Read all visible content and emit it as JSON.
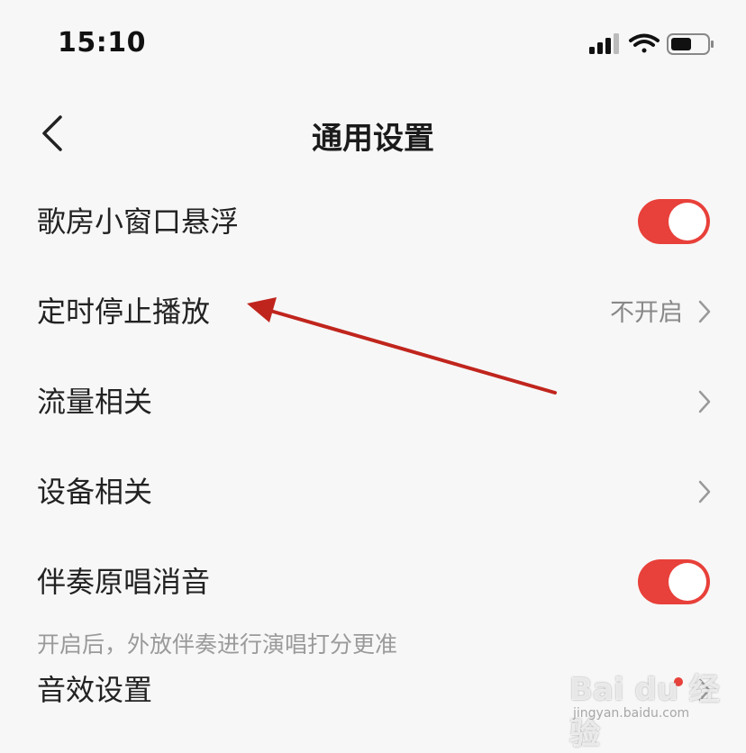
{
  "status_bar": {
    "time": "15:10",
    "icons": [
      "signal-icon",
      "wifi-icon",
      "battery-icon"
    ]
  },
  "nav": {
    "title": "通用设置",
    "back_icon": "chevron-left-icon"
  },
  "settings": [
    {
      "label": "歌房小窗口悬浮",
      "control": "toggle",
      "on": true
    },
    {
      "label": "定时停止播放",
      "control": "chevron",
      "value": "不开启"
    },
    {
      "label": "流量相关",
      "control": "chevron"
    },
    {
      "label": "设备相关",
      "control": "chevron"
    },
    {
      "label": "伴奏原唱消音",
      "control": "toggle",
      "on": true,
      "hint": "开启后，外放伴奏进行演唱打分更准"
    },
    {
      "label": "音效设置",
      "control": "chevron",
      "badge": true
    }
  ],
  "watermark": {
    "brand": "Bai du 经验",
    "url": "jingyan.baidu.com"
  },
  "colors": {
    "accent": "#e8403a",
    "background": "#f7f7f7",
    "arrow": "#c0251d",
    "secondary_text": "#888888"
  }
}
